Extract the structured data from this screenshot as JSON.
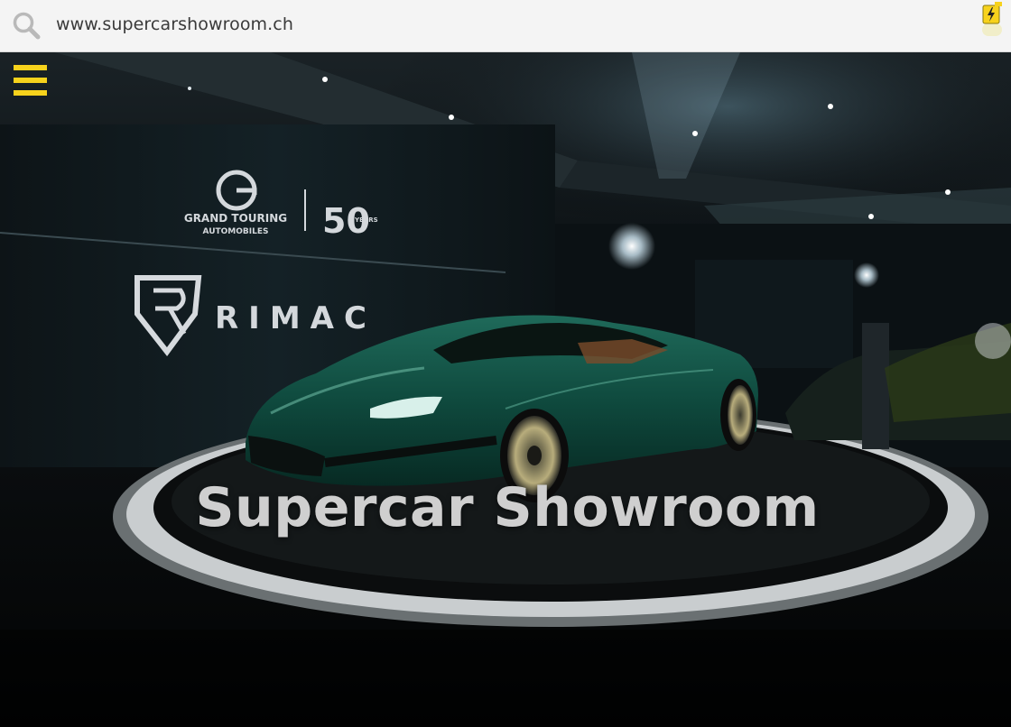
{
  "browser": {
    "url": "www.supercarshowroom.ch",
    "search_icon": "search-icon",
    "extension_icon": "bolt-icon"
  },
  "page": {
    "menu_icon": "hamburger-menu-icon",
    "title": "Supercar Showroom",
    "accent_color": "#f7d21c"
  },
  "photo": {
    "backdrop_logo_line1": "GRAND TOURING",
    "backdrop_logo_line2": "AUTOMOBILES",
    "backdrop_anniversary": "50",
    "backdrop_anniversary_sub": "YEARS",
    "backdrop_brand": "RIMAC",
    "car_color": "#0f4a3e"
  }
}
